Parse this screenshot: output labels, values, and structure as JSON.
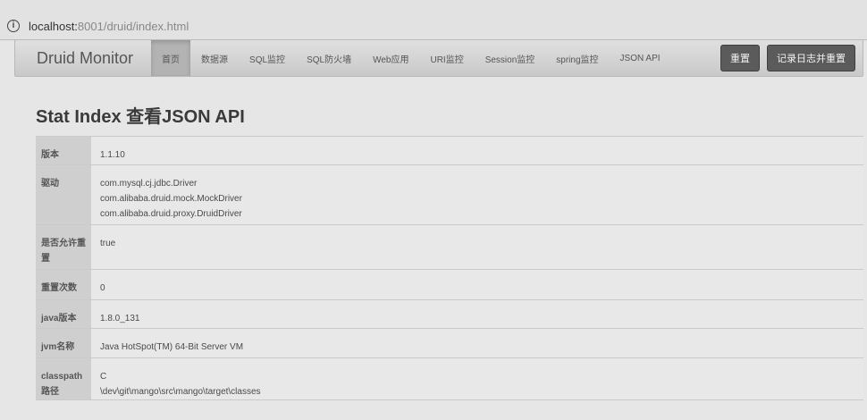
{
  "browser": {
    "url_host": "localhost:",
    "url_rest": "8001/druid/index.html"
  },
  "navbar": {
    "brand": "Druid Monitor",
    "items": [
      {
        "label": "首页",
        "active": true
      },
      {
        "label": "数据源",
        "active": false
      },
      {
        "label": "SQL监控",
        "active": false
      },
      {
        "label": "SQL防火墙",
        "active": false
      },
      {
        "label": "Web应用",
        "active": false
      },
      {
        "label": "URI监控",
        "active": false
      },
      {
        "label": "Session监控",
        "active": false
      },
      {
        "label": "spring监控",
        "active": false
      },
      {
        "label": "JSON API",
        "active": false
      }
    ],
    "reset_button": "重置",
    "log_reset_button": "记录日志并重置"
  },
  "page": {
    "title": "Stat Index 查看JSON API"
  },
  "table": {
    "rows": [
      {
        "key": "版本",
        "values": [
          "1.1.10"
        ],
        "height": 32
      },
      {
        "key": "驱动",
        "values": [
          "com.mysql.cj.jdbc.Driver",
          "com.alibaba.druid.mock.MockDriver",
          "com.alibaba.druid.proxy.DruidDriver"
        ],
        "height": 67
      },
      {
        "key": "是否允许重置",
        "values": [
          "true"
        ],
        "height": 50
      },
      {
        "key": "重置次数",
        "values": [
          "0"
        ],
        "height": 34
      },
      {
        "key": "java版本",
        "values": [
          "1.8.0_131"
        ],
        "height": 32
      },
      {
        "key": "jvm名称",
        "values": [
          "Java HotSpot(TM) 64-Bit Server VM"
        ],
        "height": 33
      },
      {
        "key": "classpath路径",
        "values": [
          "C",
          "\\dev\\git\\mango\\src\\mango\\target\\classes"
        ],
        "height": 42
      }
    ]
  }
}
